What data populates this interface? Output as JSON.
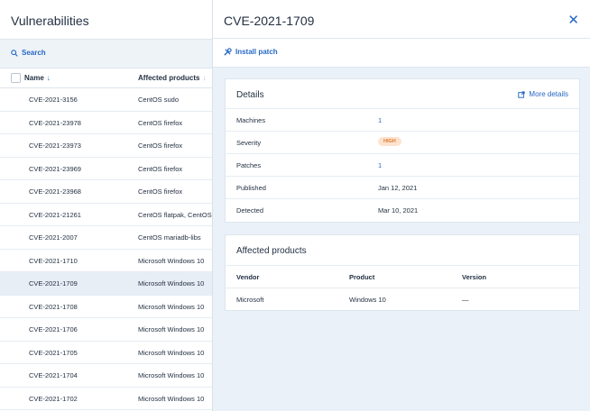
{
  "left": {
    "title": "Vulnerabilities",
    "search_label": "Search",
    "columns": {
      "name": "Name",
      "name_sort": "↓",
      "products": "Affected products",
      "products_sort": "↓"
    },
    "rows": [
      {
        "cve": "CVE-2021-3156",
        "product": "CentOS sudo"
      },
      {
        "cve": "CVE-2021-23978",
        "product": "CentOS firefox"
      },
      {
        "cve": "CVE-2021-23973",
        "product": "CentOS firefox"
      },
      {
        "cve": "CVE-2021-23969",
        "product": "CentOS firefox"
      },
      {
        "cve": "CVE-2021-23968",
        "product": "CentOS firefox"
      },
      {
        "cve": "CVE-2021-21261",
        "product": "CentOS flatpak, CentOS"
      },
      {
        "cve": "CVE-2021-2007",
        "product": "CentOS mariadb-libs"
      },
      {
        "cve": "CVE-2021-1710",
        "product": "Microsoft Windows 10"
      },
      {
        "cve": "CVE-2021-1709",
        "product": "Microsoft Windows 10"
      },
      {
        "cve": "CVE-2021-1708",
        "product": "Microsoft Windows 10"
      },
      {
        "cve": "CVE-2021-1706",
        "product": "Microsoft Windows 10"
      },
      {
        "cve": "CVE-2021-1705",
        "product": "Microsoft Windows 10"
      },
      {
        "cve": "CVE-2021-1704",
        "product": "Microsoft Windows 10"
      },
      {
        "cve": "CVE-2021-1702",
        "product": "Microsoft Windows 10"
      }
    ],
    "selected_row": "CVE-2021-1709"
  },
  "detail": {
    "title": "CVE-2021-1709",
    "close_icon": "close-icon",
    "install_label": "Install patch",
    "details_card": {
      "title": "Details",
      "more_label": "More details",
      "rows": [
        {
          "key": "Machines",
          "value": "1"
        },
        {
          "key": "Severity",
          "value": "HIGH"
        },
        {
          "key": "Patches",
          "value": "1"
        },
        {
          "key": "Published",
          "value": "Jan 12, 2021"
        },
        {
          "key": "Detected",
          "value": "Mar 10, 2021"
        }
      ]
    },
    "affected_card": {
      "title": "Affected products",
      "headers": {
        "vendor": "Vendor",
        "product": "Product",
        "version": "Version"
      },
      "rows": [
        {
          "vendor": "Microsoft",
          "product": "Windows 10",
          "version": "—"
        }
      ]
    }
  },
  "colors": {
    "accent": "#2668c5",
    "badge_bg": "#fde3cf",
    "badge_text": "#e07a2f",
    "pane_bg": "#eaf1f9"
  }
}
